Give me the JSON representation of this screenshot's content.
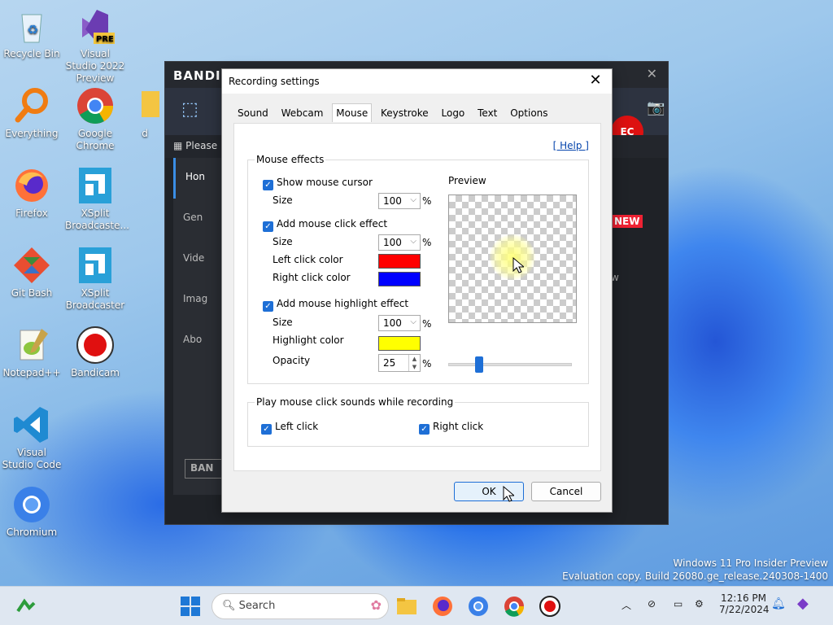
{
  "desktop": {
    "icons": [
      {
        "label": "Recycle Bin"
      },
      {
        "label": "Visual Studio 2022 Preview",
        "badge": "PRE"
      },
      {
        "label": "Everything"
      },
      {
        "label": "Google Chrome"
      },
      {
        "label": "d"
      },
      {
        "label": "Firefox"
      },
      {
        "label": "XSplit Broadcaste..."
      },
      {
        "label": "Git Bash"
      },
      {
        "label": "XSplit Broadcaster"
      },
      {
        "label": "Notepad++"
      },
      {
        "label": "Bandicam"
      },
      {
        "label": "Visual Studio Code"
      },
      {
        "label": "Chromium"
      }
    ],
    "watermark": {
      "line1": "Windows 11 Pro Insider Preview",
      "line2": "Evaluation copy. Build 26080.ge_release.240308-1400"
    }
  },
  "bandicam": {
    "logo": "BANDIC",
    "please": "Please",
    "side": [
      "Hon",
      "Gen",
      "Vide",
      "Imag",
      "Abo"
    ],
    "rec": "EC",
    "new_badge": "NEW",
    "ban_button": "BAN",
    "w_text": "w"
  },
  "dialog": {
    "title": "Recording settings",
    "tabs": [
      "Sound",
      "Webcam",
      "Mouse",
      "Keystroke",
      "Logo",
      "Text",
      "Options"
    ],
    "active_tab": "Mouse",
    "help": "[ Help ]",
    "mouse_effects": {
      "legend": "Mouse effects",
      "show_cursor": {
        "label": "Show mouse cursor",
        "checked": true
      },
      "show_cursor_size": {
        "label": "Size",
        "value": "100",
        "unit": "%"
      },
      "click_effect": {
        "label": "Add mouse click effect",
        "checked": true
      },
      "click_size": {
        "label": "Size",
        "value": "100",
        "unit": "%"
      },
      "left_click_color": {
        "label": "Left click color",
        "color": "#ff0000"
      },
      "right_click_color": {
        "label": "Right click color",
        "color": "#0000ff"
      },
      "highlight_effect": {
        "label": "Add mouse highlight effect",
        "checked": true
      },
      "highlight_size": {
        "label": "Size",
        "value": "100",
        "unit": "%"
      },
      "highlight_color": {
        "label": "Highlight color",
        "color": "#ffff00"
      },
      "opacity": {
        "label": "Opacity",
        "value": "25",
        "unit": "%"
      },
      "preview_label": "Preview",
      "opacity_slider_fraction": 0.25
    },
    "sounds": {
      "legend": "Play mouse click sounds while recording",
      "left_click": {
        "label": "Left click",
        "checked": true
      },
      "right_click": {
        "label": "Right click",
        "checked": true
      }
    },
    "ok": "OK",
    "cancel": "Cancel"
  },
  "taskbar": {
    "search_placeholder": "Search",
    "time": "12:16 PM",
    "date": "7/22/2024"
  }
}
